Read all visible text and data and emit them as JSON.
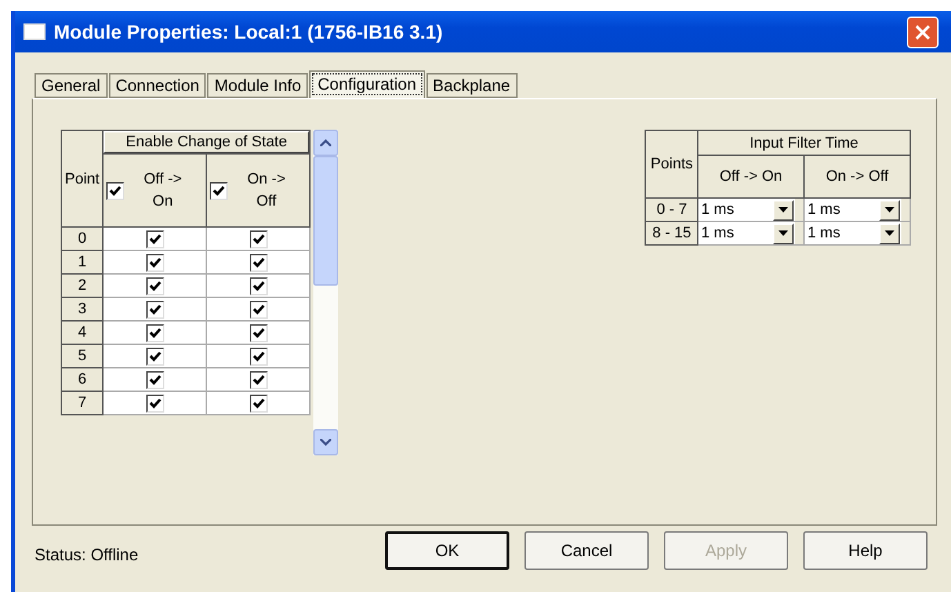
{
  "window": {
    "title": "Module Properties: Local:1 (1756-IB16 3.1)"
  },
  "tabs": [
    {
      "label": "General",
      "selected": false
    },
    {
      "label": "Connection",
      "selected": false
    },
    {
      "label": "Module Info",
      "selected": false
    },
    {
      "label": "Configuration",
      "selected": true
    },
    {
      "label": "Backplane",
      "selected": false
    }
  ],
  "cos_table": {
    "group_header": "Enable Change of State",
    "point_header": "Point",
    "columns": [
      {
        "label_line1": "Off ->",
        "label_line2": "On",
        "checked": true
      },
      {
        "label_line1": "On ->",
        "label_line2": "Off",
        "checked": true
      }
    ],
    "rows": [
      {
        "point": "0",
        "off_on": true,
        "on_off": true
      },
      {
        "point": "1",
        "off_on": true,
        "on_off": true
      },
      {
        "point": "2",
        "off_on": true,
        "on_off": true
      },
      {
        "point": "3",
        "off_on": true,
        "on_off": true
      },
      {
        "point": "4",
        "off_on": true,
        "on_off": true
      },
      {
        "point": "5",
        "off_on": true,
        "on_off": true
      },
      {
        "point": "6",
        "off_on": true,
        "on_off": true
      },
      {
        "point": "7",
        "off_on": true,
        "on_off": true
      }
    ]
  },
  "filter_table": {
    "group_header": "Input Filter Time",
    "points_header": "Points",
    "columns": [
      "Off -> On",
      "On -> Off"
    ],
    "rows": [
      {
        "points": "0 - 7",
        "off_on": "1 ms",
        "on_off": "1 ms"
      },
      {
        "points": "8 - 15",
        "off_on": "1 ms",
        "on_off": "1 ms"
      }
    ]
  },
  "status": "Status:  Offline",
  "buttons": [
    {
      "label": "OK",
      "disabled": false,
      "default": true
    },
    {
      "label": "Cancel",
      "disabled": false,
      "default": false
    },
    {
      "label": "Apply",
      "disabled": true,
      "default": false
    },
    {
      "label": "Help",
      "disabled": false,
      "default": false
    }
  ]
}
